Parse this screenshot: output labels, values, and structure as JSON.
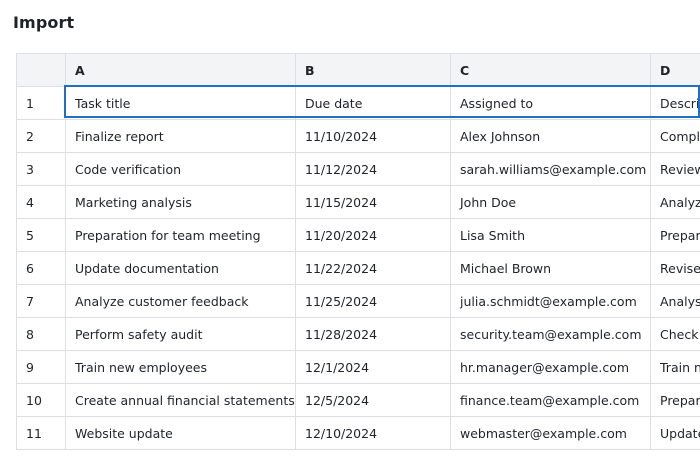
{
  "page": {
    "title": "Import"
  },
  "sheet": {
    "columns": [
      "A",
      "B",
      "C",
      "D"
    ],
    "rows": [
      {
        "num": "1",
        "cells": [
          "Task title",
          "Due date",
          "Assigned to",
          "Descri"
        ]
      },
      {
        "num": "2",
        "cells": [
          "Finalize report",
          "11/10/2024",
          "Alex Johnson",
          "Compl"
        ]
      },
      {
        "num": "3",
        "cells": [
          "Code verification",
          "11/12/2024",
          "sarah.williams@example.com",
          "Review"
        ]
      },
      {
        "num": "4",
        "cells": [
          "Marketing analysis",
          "11/15/2024",
          "John Doe",
          "Analyz"
        ]
      },
      {
        "num": "5",
        "cells": [
          "Preparation for team meeting",
          "11/20/2024",
          "Lisa Smith",
          "Prepar"
        ]
      },
      {
        "num": "6",
        "cells": [
          "Update documentation",
          "11/22/2024",
          "Michael Brown",
          "Revise"
        ]
      },
      {
        "num": "7",
        "cells": [
          "Analyze customer feedback",
          "11/25/2024",
          "julia.schmidt@example.com",
          "Analys"
        ]
      },
      {
        "num": "8",
        "cells": [
          "Perform safety audit",
          "11/28/2024",
          "security.team@example.com",
          "Check"
        ]
      },
      {
        "num": "9",
        "cells": [
          "Train new employees",
          "12/1/2024",
          "hr.manager@example.com",
          "Train n"
        ]
      },
      {
        "num": "10",
        "cells": [
          "Create annual financial statements",
          "12/5/2024",
          "finance.team@example.com",
          "Prepar"
        ]
      },
      {
        "num": "11",
        "cells": [
          "Website update",
          "12/10/2024",
          "webmaster@example.com",
          "Update"
        ]
      }
    ],
    "selection_color": "#1f6fc5"
  }
}
